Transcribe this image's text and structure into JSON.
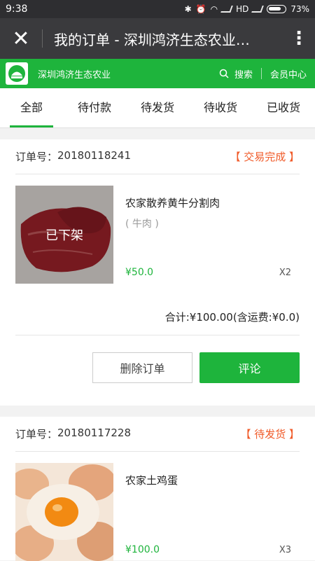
{
  "status_bar": {
    "time": "9:38",
    "network": "HD",
    "battery": "73%"
  },
  "title_bar": {
    "title": "我的订单 - 深圳鸿济生态农业…"
  },
  "site_bar": {
    "name": "深圳鸿济生态农业",
    "search_label": "搜索",
    "member_label": "会员中心"
  },
  "tabs": [
    {
      "label": "全部"
    },
    {
      "label": "待付款"
    },
    {
      "label": "待发货"
    },
    {
      "label": "待收货"
    },
    {
      "label": "已收货"
    }
  ],
  "orders": [
    {
      "order_no_label": "订单号：",
      "order_no": "20180118241",
      "status": "【 交易完成 】",
      "item_name": "农家散养黄牛分割肉",
      "item_spec": "( 牛肉 )",
      "item_overlay": "已下架",
      "price": "¥50.0",
      "qty": "X2",
      "total": "合计:¥100.00(含运费:¥0.0)",
      "delete_label": "删除订单",
      "comment_label": "评论"
    },
    {
      "order_no_label": "订单号：",
      "order_no": "20180117228",
      "status": "【 待发货 】",
      "item_name": "农家土鸡蛋",
      "price": "¥100.0",
      "qty": "X3"
    }
  ],
  "colors": {
    "brand_green": "#1eb43c",
    "status_orange": "#f05a28"
  }
}
